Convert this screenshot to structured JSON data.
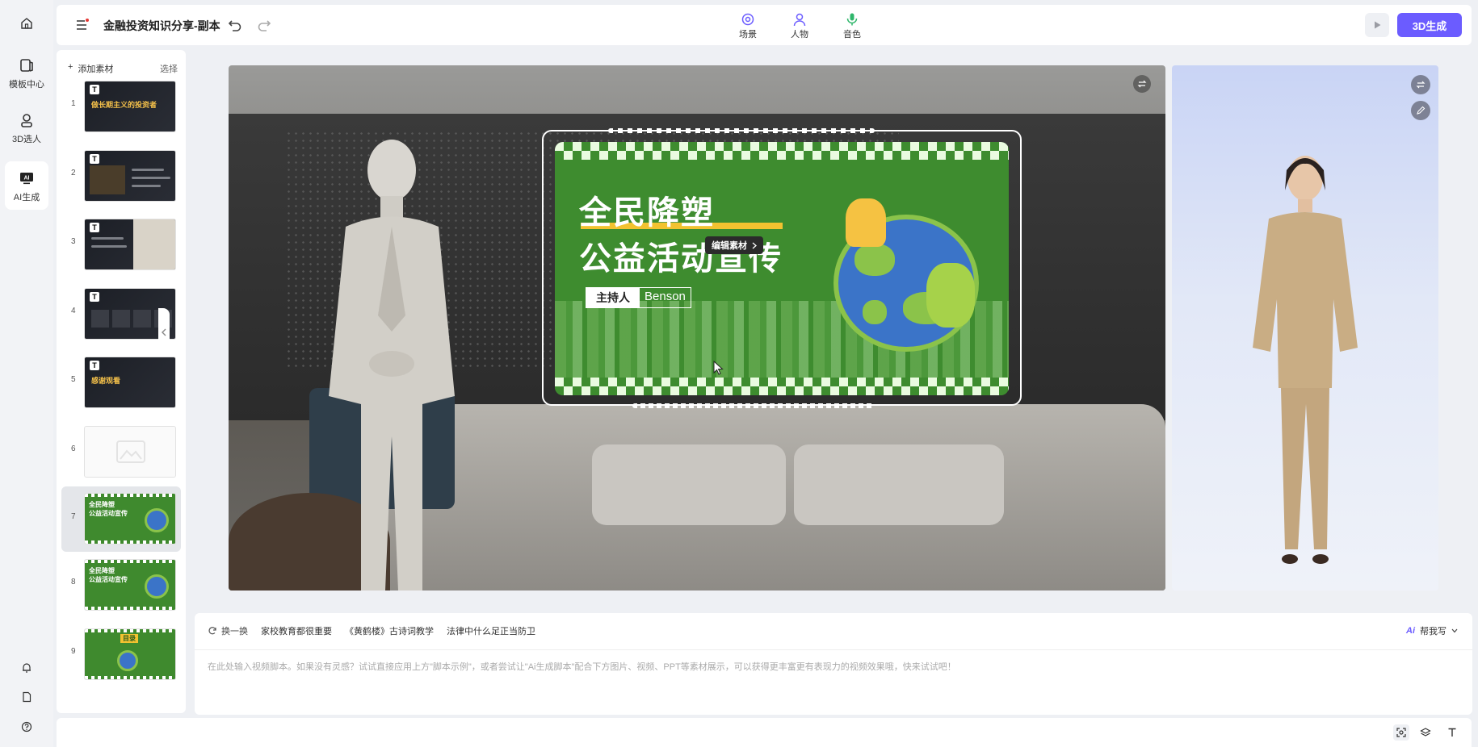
{
  "app": {
    "title": "金融投资知识分享-副本",
    "accent_color": "#6b5cff"
  },
  "rail": {
    "items": [
      {
        "label": "模板中心",
        "icon": "template-icon"
      },
      {
        "label": "3D选人",
        "icon": "person-3d-icon"
      },
      {
        "label": "AI生成",
        "icon": "ai-icon",
        "active": true
      }
    ],
    "bottom_icons": [
      "bell-icon",
      "file-icon",
      "help-icon"
    ]
  },
  "topbar": {
    "tools": [
      {
        "label": "场景",
        "icon": "scene-icon"
      },
      {
        "label": "人物",
        "icon": "person-icon"
      },
      {
        "label": "音色",
        "icon": "mic-icon"
      }
    ],
    "generate_label": "3D生成"
  },
  "slides": {
    "add_label": "添加素材",
    "select_label": "选择",
    "items": [
      {
        "num": "1",
        "style": "dark",
        "text": "做长期主义的投资者"
      },
      {
        "num": "2",
        "style": "dark",
        "text": ""
      },
      {
        "num": "3",
        "style": "dark",
        "text": ""
      },
      {
        "num": "4",
        "style": "dark",
        "text": ""
      },
      {
        "num": "5",
        "style": "dark",
        "text": "感谢观看"
      },
      {
        "num": "6",
        "style": "empty",
        "text": ""
      },
      {
        "num": "7",
        "style": "green",
        "text": "全民降塑\n公益活动宣传",
        "selected": true
      },
      {
        "num": "8",
        "style": "green",
        "text": "全民降塑\n公益活动宣传"
      },
      {
        "num": "9",
        "style": "green",
        "text": "目录"
      }
    ]
  },
  "canvas": {
    "slide_title_1": "全民降塑",
    "slide_title_2": "公益活动宣传",
    "host_label": "主持人",
    "host_name": "Benson",
    "edit_chip": "编辑素材"
  },
  "script": {
    "refresh_label": "换一换",
    "examples": [
      "家校教育都很重要",
      "《黄鹤楼》古诗词教学",
      "法律中什么足正当防卫"
    ],
    "help_write": "帮我写",
    "placeholder": "在此处输入视频脚本。如果没有灵感？试试直接应用上方\"脚本示例\"，或者尝试让\"Ai生成脚本\"配合下方图片、视频、PPT等素材展示，可以获得更丰富更有表现力的视频效果哦，快来试试吧！"
  }
}
